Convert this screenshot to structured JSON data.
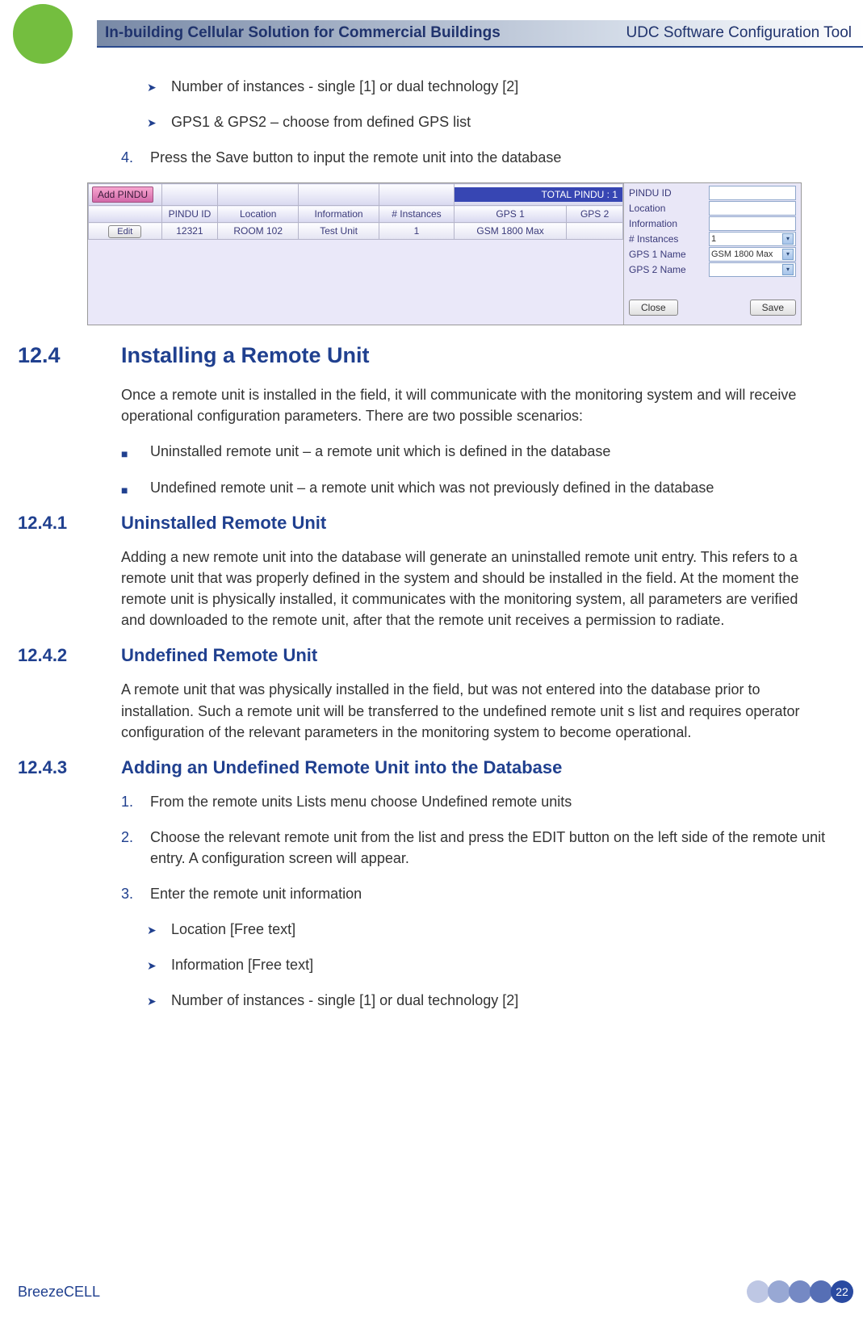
{
  "header": {
    "title": "In-building Cellular Solution for Commercial Buildings",
    "tool": "UDC Software Configuration Tool"
  },
  "top_bullets": [
    "Number of instances - single [1] or dual technology [2]",
    "GPS1 & GPS2 – choose from defined GPS list"
  ],
  "step4_num": "4.",
  "step4_text": "Press the Save button to input the remote unit into the database",
  "screenshot": {
    "add_btn": "Add PINDU",
    "total_label": "TOTAL PINDU : 1",
    "columns": [
      "PINDU ID",
      "Location",
      "Information",
      "# Instances",
      "GPS 1",
      "GPS 2"
    ],
    "edit_btn": "Edit",
    "row": {
      "pindu_id": "12321",
      "location": "ROOM 102",
      "information": "Test Unit",
      "instances": "1",
      "gps1": "GSM 1800 Max",
      "gps2": ""
    },
    "side_labels": {
      "pindu_id": "PINDU ID",
      "location": "Location",
      "information": "Information",
      "instances": "# Instances",
      "gps1": "GPS 1 Name",
      "gps2": "GPS 2 Name"
    },
    "side_values": {
      "instances": "1",
      "gps1": "GSM 1800 Max"
    },
    "close_btn": "Close",
    "save_btn": "Save"
  },
  "s124": {
    "num": "12.4",
    "title": "Installing a Remote Unit",
    "intro": "Once a remote unit is installed in the field, it will communicate with the monitoring system and will receive operational configuration parameters. There are two possible scenarios:",
    "bullets": [
      "Uninstalled remote unit – a remote unit which is defined in the database",
      "Undefined remote unit – a remote unit which was not previously defined in the database"
    ]
  },
  "s1241": {
    "num": "12.4.1",
    "title": "Uninstalled Remote Unit",
    "para": "Adding a new remote unit into the database will generate an uninstalled remote unit entry. This refers to a remote unit that was properly defined in the system and should be installed in the field. At the moment the remote unit is physically installed, it communicates with the monitoring system, all parameters are verified and downloaded to the remote unit, after that the remote unit receives a permission to radiate."
  },
  "s1242": {
    "num": "12.4.2",
    "title": "Undefined Remote Unit",
    "para": "A remote unit that was physically installed in the field, but was not entered into the database prior to installation. Such a remote unit will be transferred to the undefined remote unit s list and requires operator configuration of the relevant parameters in the monitoring system to become operational."
  },
  "s1243": {
    "num": "12.4.3",
    "title": "Adding an Undefined Remote Unit into the Database",
    "steps": [
      {
        "num": "1.",
        "text": "From the remote units Lists menu choose Undefined remote units"
      },
      {
        "num": "2.",
        "text": "Choose the relevant remote unit from the list and press the EDIT button on the left side of the remote unit entry. A configuration screen will appear."
      },
      {
        "num": "3.",
        "text": "Enter the remote unit information"
      }
    ],
    "sub_bullets": [
      "Location [Free text]",
      "Information [Free text]",
      "Number of instances - single [1] or dual technology [2]"
    ]
  },
  "footer": {
    "brand": "BreezeCELL",
    "page_number": "22"
  }
}
